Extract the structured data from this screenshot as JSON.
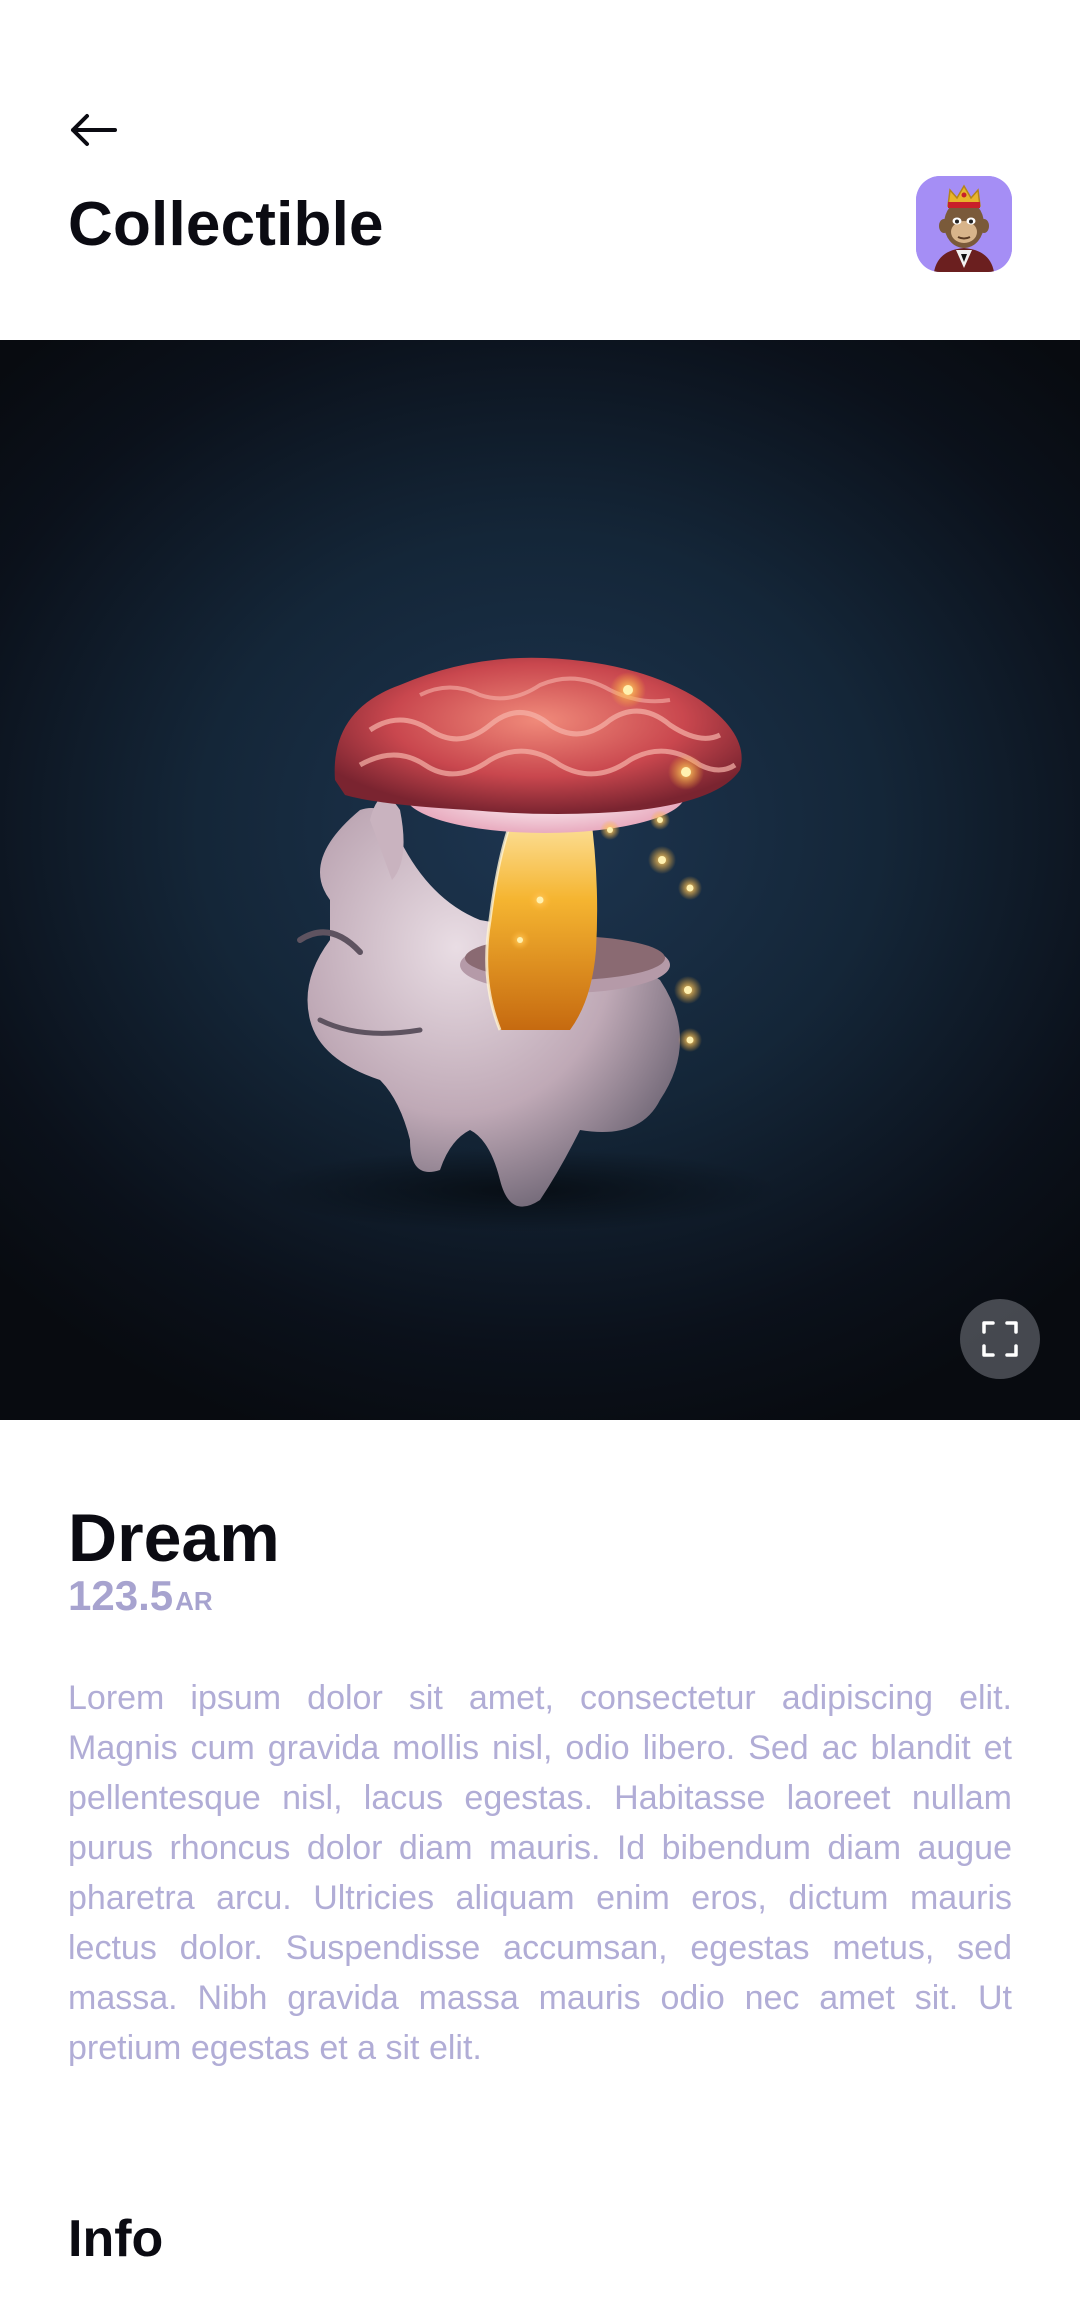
{
  "header": {
    "title": "Collectible",
    "back_icon": "arrow-left-icon",
    "avatar_icon": "ape-avatar-icon",
    "avatar_color": "#a58ef5"
  },
  "hero": {
    "image": "mushroom-creature-image",
    "fullscreen_icon": "fullscreen-icon"
  },
  "item": {
    "name": "Dream",
    "price_value": "123.5",
    "price_unit": "AR",
    "description": "Lorem ipsum dolor sit amet, consectetur adipiscing elit. Magnis cum gravida mollis nisl, odio libero. Sed ac blandit et pellentesque nisl, lacus egestas. Habitasse laoreet nullam purus rhoncus dolor diam mauris. Id bibendum diam augue pharetra arcu. Ultricies aliquam enim eros, dictum mauris lectus dolor. Suspendisse accumsan, egestas metus, sed massa. Nibh gravida massa mauris odio nec amet sit. Ut pretium egestas et a sit elit."
  },
  "sections": {
    "info_title": "Info"
  },
  "colors": {
    "accent_muted": "#a7a3cf",
    "text_primary": "#0b0b12"
  }
}
